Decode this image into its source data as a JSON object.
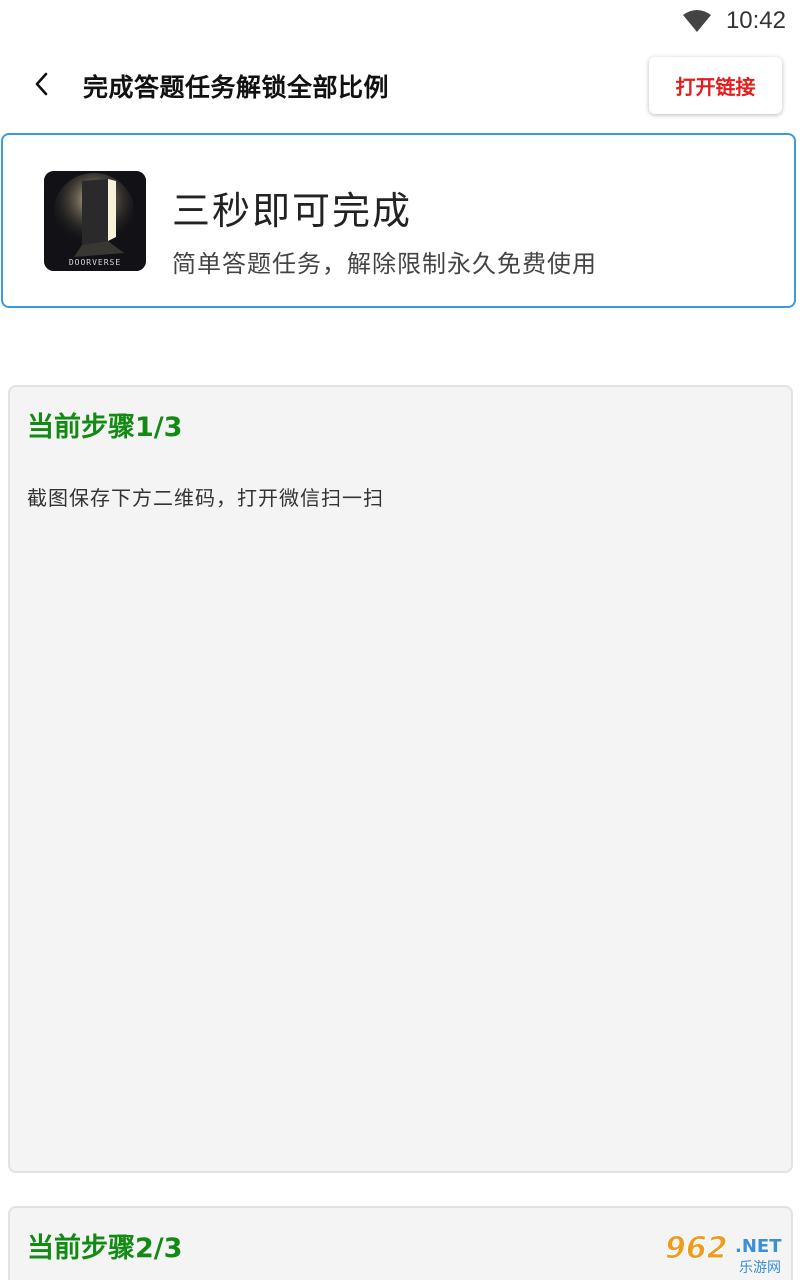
{
  "status_bar": {
    "time": "10:42",
    "wifi_icon": "wifi-icon"
  },
  "header": {
    "back_icon": "chevron-left-icon",
    "title": "完成答题任务解锁全部比例",
    "open_link_label": "打开链接"
  },
  "info_card": {
    "app_icon": "door-app-icon",
    "app_icon_text": "DOORVERSE",
    "title": "三秒即可完成",
    "subtitle": "简单答题任务，解除限制永久免费使用"
  },
  "steps": [
    {
      "title": "当前步骤1/3",
      "description": "截图保存下方二维码，打开微信扫一扫"
    },
    {
      "title": "当前步骤2/3"
    }
  ],
  "watermark": {
    "number": "962",
    "suffix": ".NET",
    "caption": "乐游网"
  },
  "colors": {
    "accent_red": "#e21d1d",
    "step_green": "#138a13",
    "card_border_blue": "#3d9ae0",
    "step_bg": "#f4f4f4"
  }
}
